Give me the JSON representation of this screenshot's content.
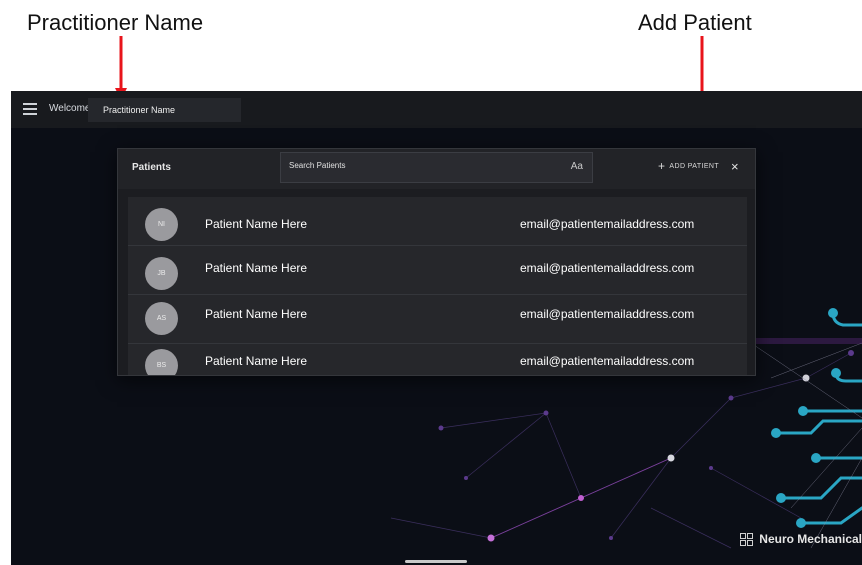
{
  "annotations": {
    "practitioner_label": "Practitioner Name",
    "add_patient_label": "Add Patient"
  },
  "topbar": {
    "welcome": "Welcome",
    "practitioner_name": "Practitioner Name"
  },
  "dialog": {
    "title": "Patients",
    "search_placeholder": "Search Patients",
    "search_case_icon": "Aa",
    "add_patient_label": "ADD PATIENT",
    "add_icon": "+",
    "close_icon": "×"
  },
  "patients": [
    {
      "initials": "NI",
      "name": "Patient Name Here",
      "email": "email@patientemailaddress.com"
    },
    {
      "initials": "JB",
      "name": "Patient Name Here",
      "email": "email@patientemailaddress.com"
    },
    {
      "initials": "AS",
      "name": "Patient Name Here",
      "email": "email@patientemailaddress.com"
    },
    {
      "initials": "BS",
      "name": "Patient Name Here",
      "email": "email@patientemailaddress.com"
    }
  ],
  "brand": {
    "name": "Neuro Mechanical",
    "icon": "grid-icon"
  },
  "colors": {
    "app_background": "#0b0e16",
    "topbar": "#181a1e",
    "dialog": "#1c1d21",
    "list": "#26272b",
    "avatar": "#9a9a9e",
    "annotation_arrow": "#e8141b",
    "network_teal": "#2aa6c4",
    "network_purple": "#8a4fc4"
  }
}
